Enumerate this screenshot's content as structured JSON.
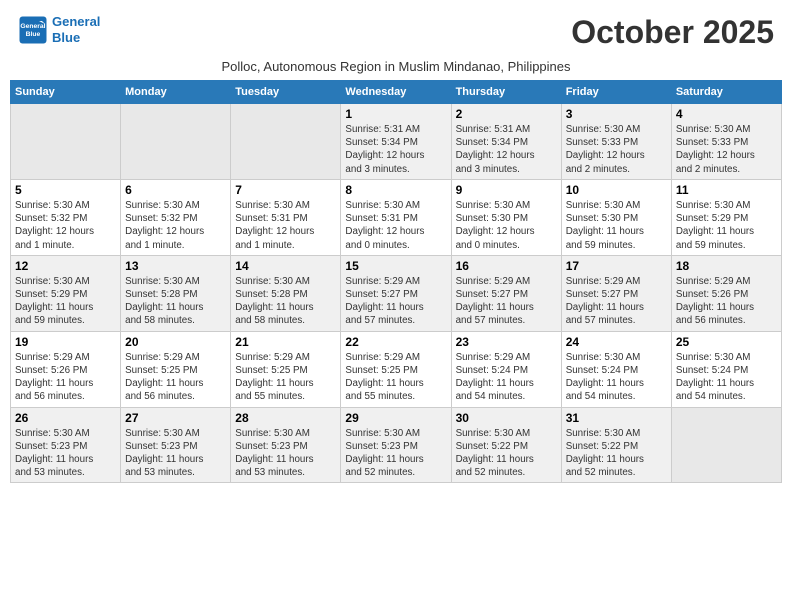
{
  "header": {
    "logo_line1": "General",
    "logo_line2": "Blue",
    "month_title": "October 2025",
    "subtitle": "Polloc, Autonomous Region in Muslim Mindanao, Philippines"
  },
  "weekdays": [
    "Sunday",
    "Monday",
    "Tuesday",
    "Wednesday",
    "Thursday",
    "Friday",
    "Saturday"
  ],
  "weeks": [
    [
      {
        "day": "",
        "info": ""
      },
      {
        "day": "",
        "info": ""
      },
      {
        "day": "",
        "info": ""
      },
      {
        "day": "1",
        "info": "Sunrise: 5:31 AM\nSunset: 5:34 PM\nDaylight: 12 hours\nand 3 minutes."
      },
      {
        "day": "2",
        "info": "Sunrise: 5:31 AM\nSunset: 5:34 PM\nDaylight: 12 hours\nand 3 minutes."
      },
      {
        "day": "3",
        "info": "Sunrise: 5:30 AM\nSunset: 5:33 PM\nDaylight: 12 hours\nand 2 minutes."
      },
      {
        "day": "4",
        "info": "Sunrise: 5:30 AM\nSunset: 5:33 PM\nDaylight: 12 hours\nand 2 minutes."
      }
    ],
    [
      {
        "day": "5",
        "info": "Sunrise: 5:30 AM\nSunset: 5:32 PM\nDaylight: 12 hours\nand 1 minute."
      },
      {
        "day": "6",
        "info": "Sunrise: 5:30 AM\nSunset: 5:32 PM\nDaylight: 12 hours\nand 1 minute."
      },
      {
        "day": "7",
        "info": "Sunrise: 5:30 AM\nSunset: 5:31 PM\nDaylight: 12 hours\nand 1 minute."
      },
      {
        "day": "8",
        "info": "Sunrise: 5:30 AM\nSunset: 5:31 PM\nDaylight: 12 hours\nand 0 minutes."
      },
      {
        "day": "9",
        "info": "Sunrise: 5:30 AM\nSunset: 5:30 PM\nDaylight: 12 hours\nand 0 minutes."
      },
      {
        "day": "10",
        "info": "Sunrise: 5:30 AM\nSunset: 5:30 PM\nDaylight: 11 hours\nand 59 minutes."
      },
      {
        "day": "11",
        "info": "Sunrise: 5:30 AM\nSunset: 5:29 PM\nDaylight: 11 hours\nand 59 minutes."
      }
    ],
    [
      {
        "day": "12",
        "info": "Sunrise: 5:30 AM\nSunset: 5:29 PM\nDaylight: 11 hours\nand 59 minutes."
      },
      {
        "day": "13",
        "info": "Sunrise: 5:30 AM\nSunset: 5:28 PM\nDaylight: 11 hours\nand 58 minutes."
      },
      {
        "day": "14",
        "info": "Sunrise: 5:30 AM\nSunset: 5:28 PM\nDaylight: 11 hours\nand 58 minutes."
      },
      {
        "day": "15",
        "info": "Sunrise: 5:29 AM\nSunset: 5:27 PM\nDaylight: 11 hours\nand 57 minutes."
      },
      {
        "day": "16",
        "info": "Sunrise: 5:29 AM\nSunset: 5:27 PM\nDaylight: 11 hours\nand 57 minutes."
      },
      {
        "day": "17",
        "info": "Sunrise: 5:29 AM\nSunset: 5:27 PM\nDaylight: 11 hours\nand 57 minutes."
      },
      {
        "day": "18",
        "info": "Sunrise: 5:29 AM\nSunset: 5:26 PM\nDaylight: 11 hours\nand 56 minutes."
      }
    ],
    [
      {
        "day": "19",
        "info": "Sunrise: 5:29 AM\nSunset: 5:26 PM\nDaylight: 11 hours\nand 56 minutes."
      },
      {
        "day": "20",
        "info": "Sunrise: 5:29 AM\nSunset: 5:25 PM\nDaylight: 11 hours\nand 56 minutes."
      },
      {
        "day": "21",
        "info": "Sunrise: 5:29 AM\nSunset: 5:25 PM\nDaylight: 11 hours\nand 55 minutes."
      },
      {
        "day": "22",
        "info": "Sunrise: 5:29 AM\nSunset: 5:25 PM\nDaylight: 11 hours\nand 55 minutes."
      },
      {
        "day": "23",
        "info": "Sunrise: 5:29 AM\nSunset: 5:24 PM\nDaylight: 11 hours\nand 54 minutes."
      },
      {
        "day": "24",
        "info": "Sunrise: 5:30 AM\nSunset: 5:24 PM\nDaylight: 11 hours\nand 54 minutes."
      },
      {
        "day": "25",
        "info": "Sunrise: 5:30 AM\nSunset: 5:24 PM\nDaylight: 11 hours\nand 54 minutes."
      }
    ],
    [
      {
        "day": "26",
        "info": "Sunrise: 5:30 AM\nSunset: 5:23 PM\nDaylight: 11 hours\nand 53 minutes."
      },
      {
        "day": "27",
        "info": "Sunrise: 5:30 AM\nSunset: 5:23 PM\nDaylight: 11 hours\nand 53 minutes."
      },
      {
        "day": "28",
        "info": "Sunrise: 5:30 AM\nSunset: 5:23 PM\nDaylight: 11 hours\nand 53 minutes."
      },
      {
        "day": "29",
        "info": "Sunrise: 5:30 AM\nSunset: 5:23 PM\nDaylight: 11 hours\nand 52 minutes."
      },
      {
        "day": "30",
        "info": "Sunrise: 5:30 AM\nSunset: 5:22 PM\nDaylight: 11 hours\nand 52 minutes."
      },
      {
        "day": "31",
        "info": "Sunrise: 5:30 AM\nSunset: 5:22 PM\nDaylight: 11 hours\nand 52 minutes."
      },
      {
        "day": "",
        "info": ""
      }
    ]
  ]
}
